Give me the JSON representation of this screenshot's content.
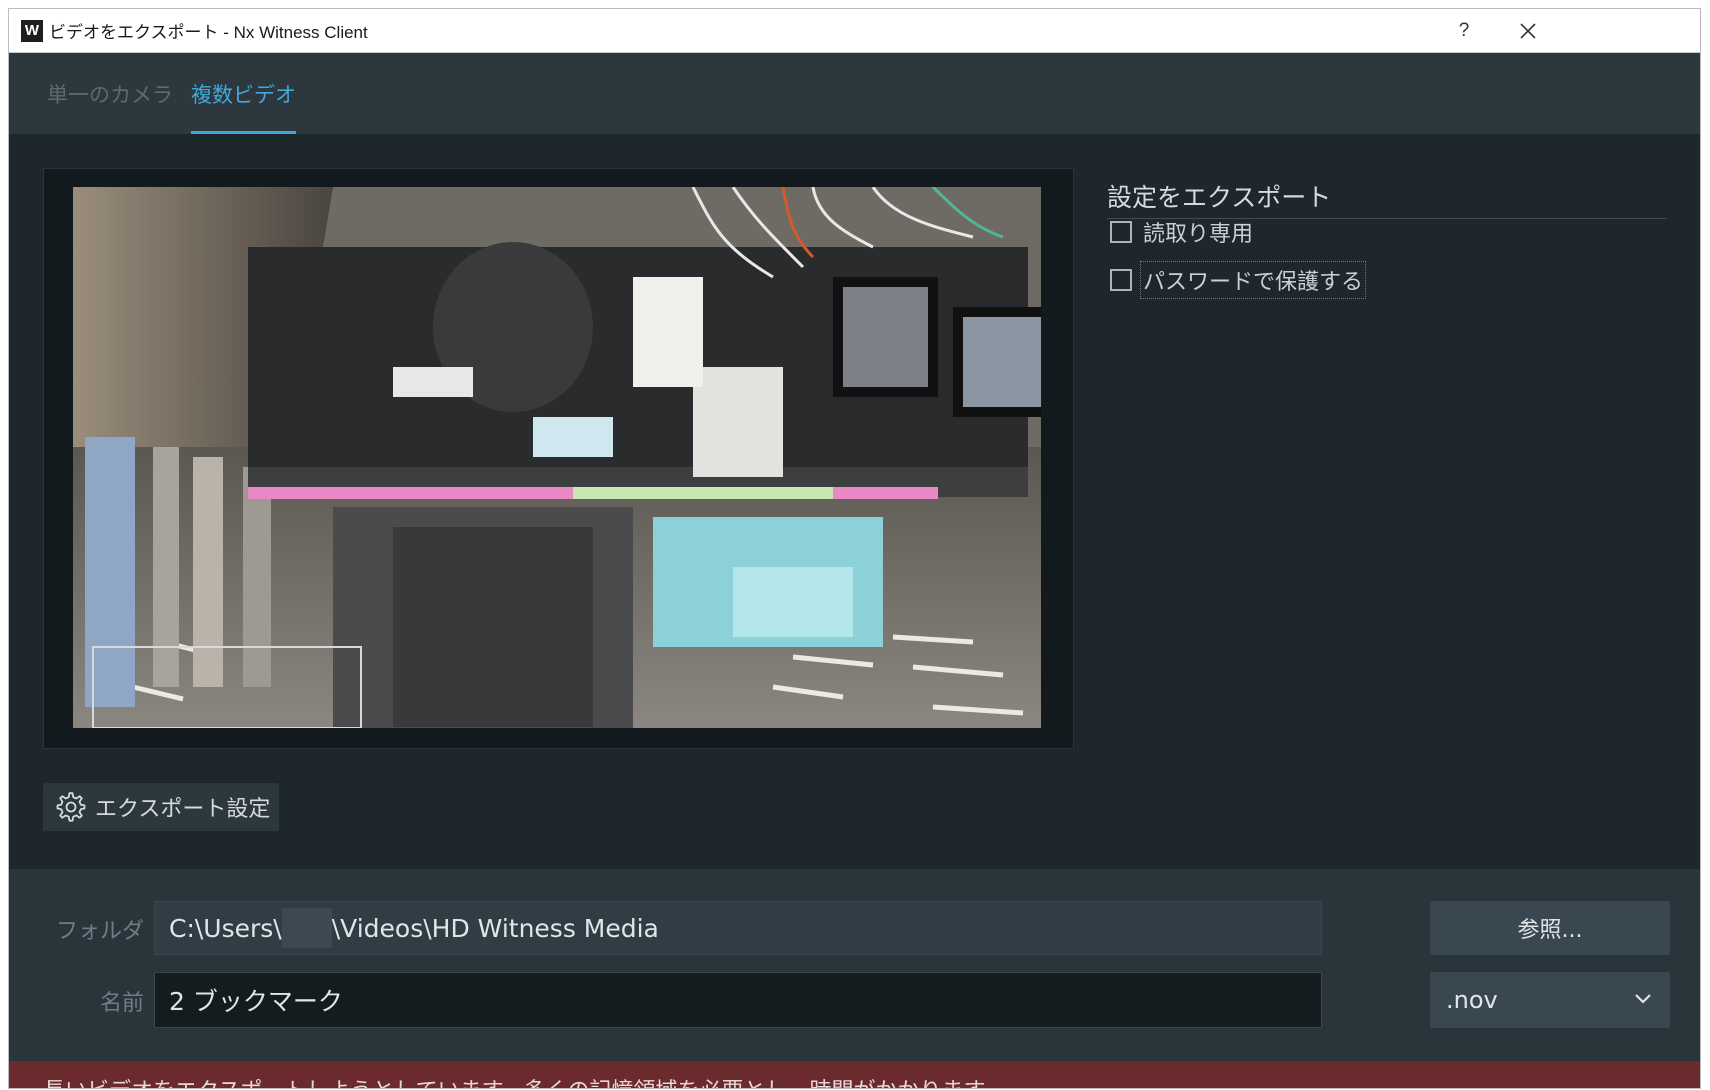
{
  "window": {
    "title": "ビデオをエクスポート - Nx Witness Client",
    "logo_letter": "W",
    "help_label": "?",
    "close_label": "✕"
  },
  "tabs": [
    {
      "label": "単一のカメラ",
      "active": false
    },
    {
      "label": "複数ビデオ",
      "active": true
    }
  ],
  "export_settings": {
    "title": "設定をエクスポート",
    "options": [
      {
        "label": "読取り専用",
        "checked": false
      },
      {
        "label": "パスワードで保護する",
        "checked": false
      }
    ],
    "button_label": "エクスポート設定"
  },
  "folder": {
    "label": "フォルダ",
    "path_prefix": "C:\\Users\\",
    "path_suffix": "\\Videos\\HD Witness Media",
    "browse_label": "参照..."
  },
  "name": {
    "label": "名前",
    "value": "2 ブックマーク",
    "format": ".nov"
  },
  "warning": {
    "text": "長いビデオをエクスポートしようとしています。多くの記憶領域を必要とし、時間がかかります。"
  }
}
